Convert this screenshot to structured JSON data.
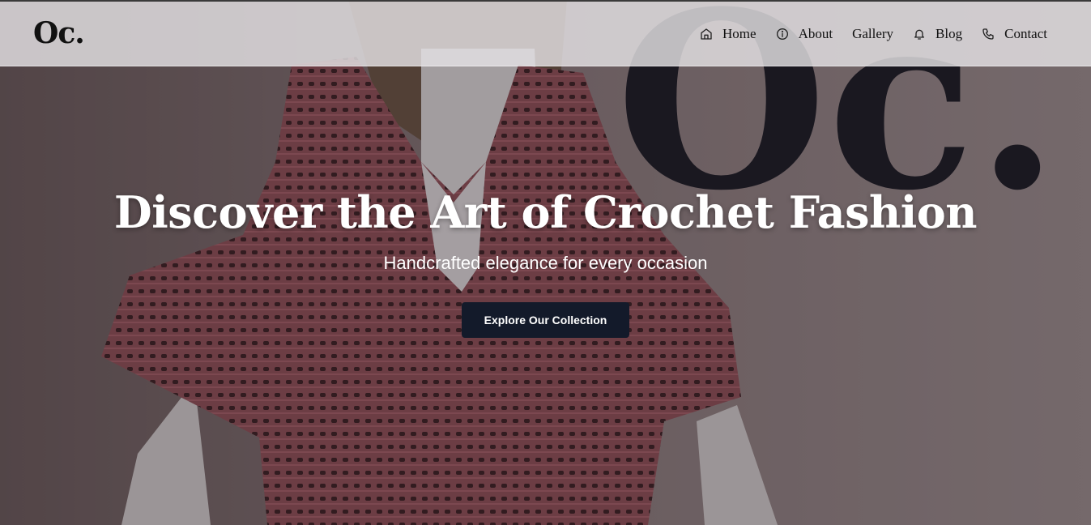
{
  "brand": {
    "logo_text": "Oc."
  },
  "nav": {
    "items": [
      {
        "label": "Home",
        "icon": "home-icon"
      },
      {
        "label": "About",
        "icon": "info-icon"
      },
      {
        "label": "Gallery",
        "icon": ""
      },
      {
        "label": "Blog",
        "icon": "bell-icon"
      },
      {
        "label": "Contact",
        "icon": "phone-icon"
      }
    ]
  },
  "hero": {
    "title": "Discover the Art of Crochet Fashion",
    "subtitle": "Handcrafted elegance for every occasion",
    "cta_label": "Explore Our Collection",
    "background_logo_text": "Oc."
  },
  "colors": {
    "navbar_bg": "#e4e2e4",
    "button_bg": "#131a2a",
    "garment": "#8e4f58",
    "text_light": "#ffffff"
  }
}
